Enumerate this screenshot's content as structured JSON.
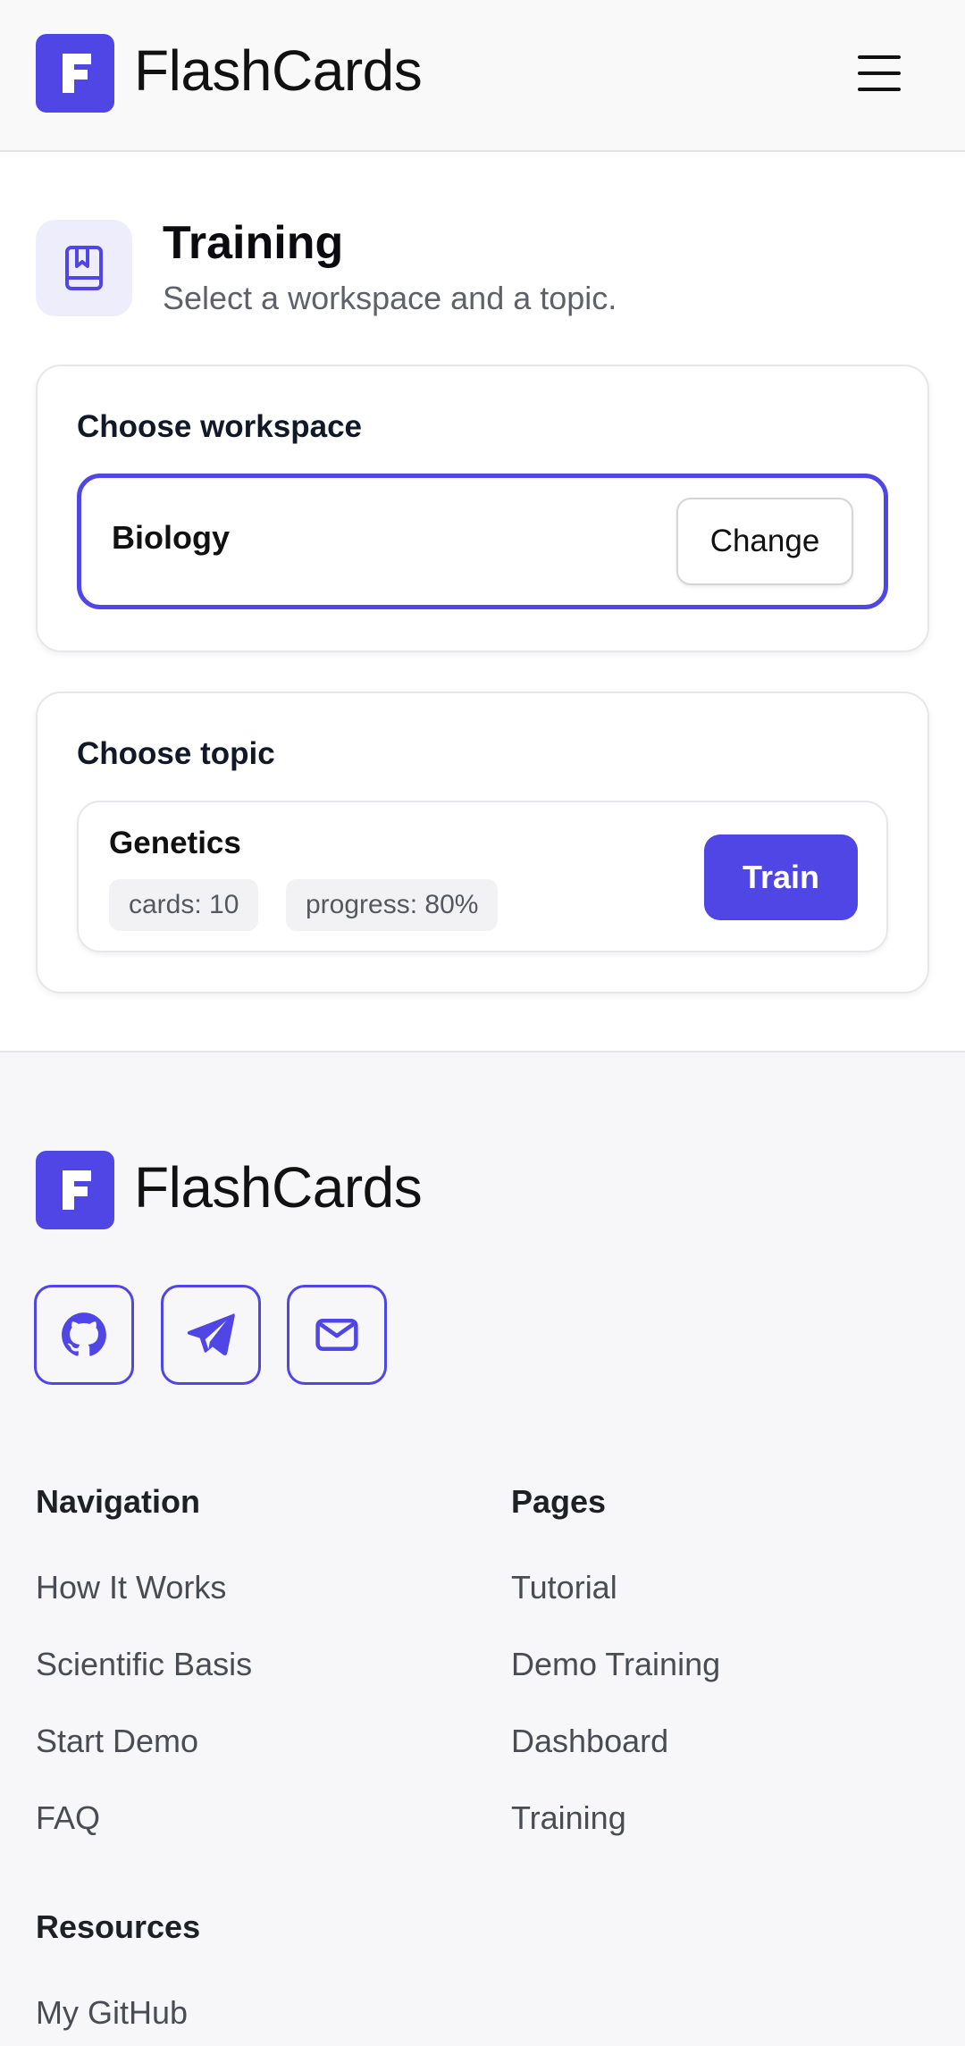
{
  "header": {
    "brand": "FlashCards",
    "logo_letter": "F",
    "menu_icon": "hamburger-menu-icon"
  },
  "main": {
    "title": "Training",
    "subtitle": "Select a workspace and a topic.",
    "icon": "bookmark-book-icon",
    "workspace": {
      "label": "Choose workspace",
      "selected": "Biology",
      "change_label": "Change"
    },
    "topic": {
      "label": "Choose topic",
      "name": "Genetics",
      "cards": "cards: 10",
      "progress": "progress: 80%",
      "train_label": "Train"
    }
  },
  "footer": {
    "brand": "FlashCards",
    "logo_letter": "F",
    "social": [
      "github-icon",
      "telegram-icon",
      "mail-icon"
    ],
    "navigation": {
      "title": "Navigation",
      "links": [
        "How It Works",
        "Scientific Basis",
        "Start Demo",
        "FAQ"
      ]
    },
    "pages": {
      "title": "Pages",
      "links": [
        "Tutorial",
        "Demo Training",
        "Dashboard",
        "Training"
      ]
    },
    "resources": {
      "title": "Resources",
      "links": [
        "My GitHub"
      ]
    }
  },
  "colors": {
    "accent": "#4f46e5",
    "accent_soft": "#eeedfc",
    "footer_bg": "#f7f7f9"
  }
}
